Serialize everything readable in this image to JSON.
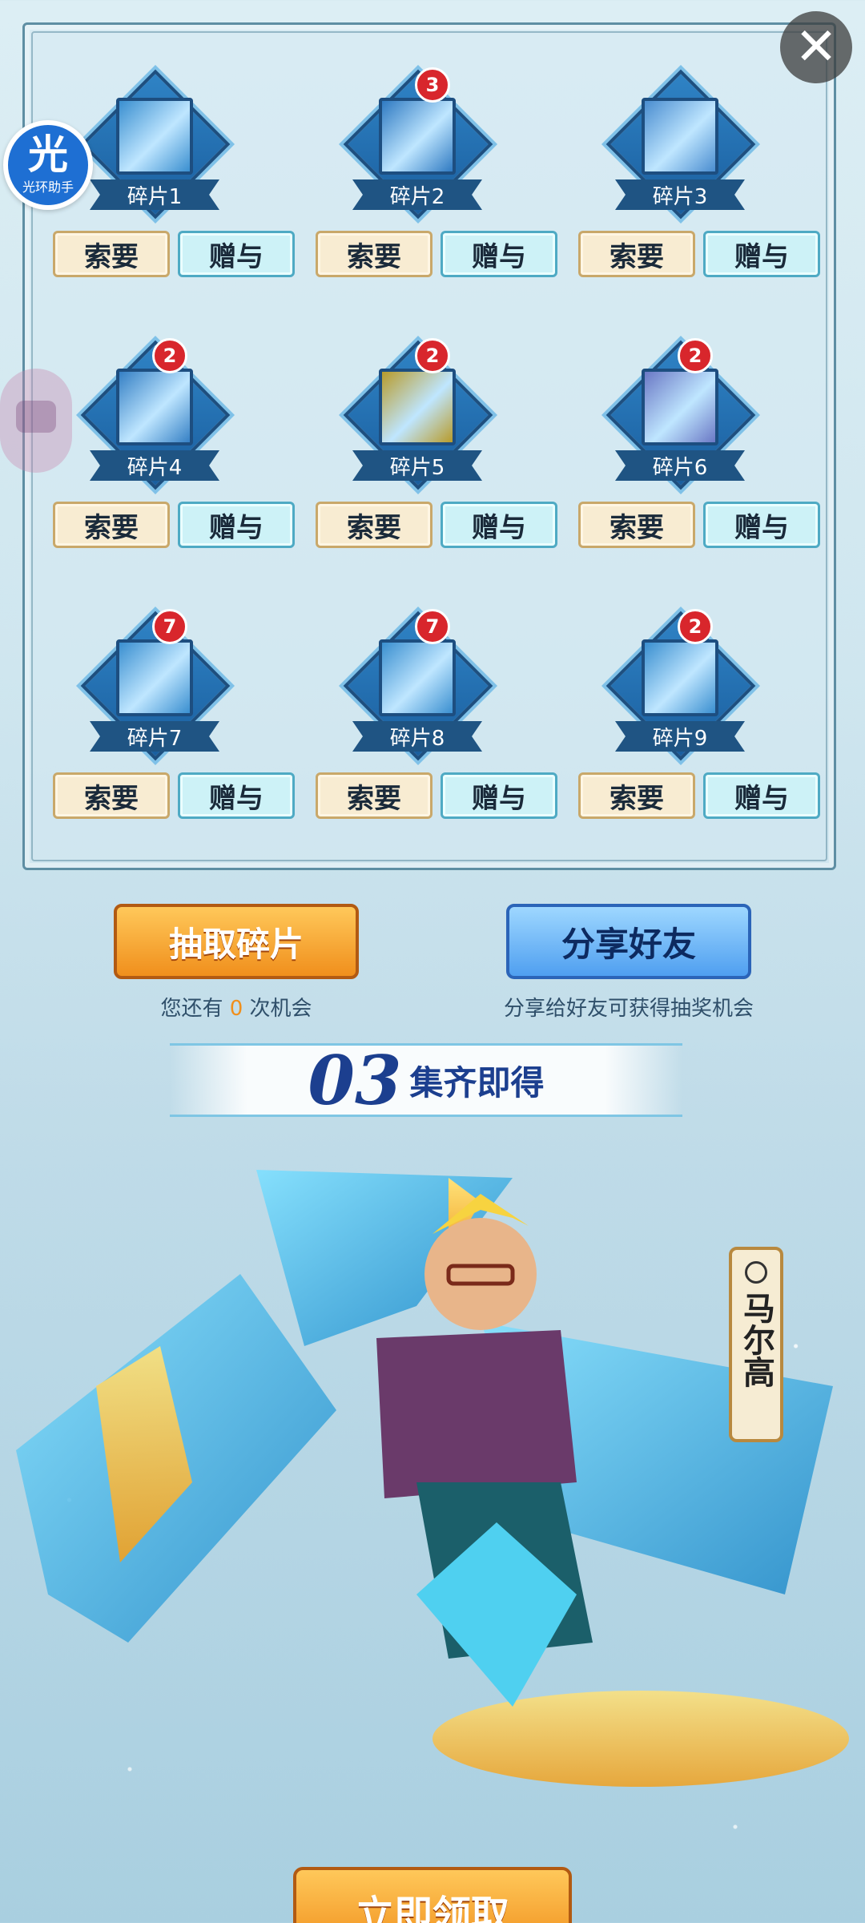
{
  "helper": {
    "badge_char": "光",
    "label": "光环助手"
  },
  "close_icon": "close-icon",
  "fragments": [
    {
      "label": "碎片1",
      "count": null,
      "color": "#3a8fd0"
    },
    {
      "label": "碎片2",
      "count": "3",
      "color": "#2f7ac2"
    },
    {
      "label": "碎片3",
      "count": null,
      "color": "#4a8dd0"
    },
    {
      "label": "碎片4",
      "count": "2",
      "color": "#3580c5"
    },
    {
      "label": "碎片5",
      "count": "2",
      "color": "#b89b2a"
    },
    {
      "label": "碎片6",
      "count": "2",
      "color": "#6a78c5"
    },
    {
      "label": "碎片7",
      "count": "7",
      "color": "#3a8fd0"
    },
    {
      "label": "碎片8",
      "count": "7",
      "color": "#3a8fd0"
    },
    {
      "label": "碎片9",
      "count": "2",
      "color": "#3a8fd0"
    }
  ],
  "buttons": {
    "ask": "索要",
    "give": "赠与"
  },
  "actions": {
    "draw": "抽取碎片",
    "share": "分享好友",
    "chance_prefix": "您还有",
    "chance_count": "0",
    "chance_suffix": "次机会",
    "share_tip": "分享给好友可获得抽奖机会"
  },
  "collect": {
    "number": "03",
    "text": "集齐即得"
  },
  "hero": {
    "name": "马尔高"
  },
  "claim": {
    "label": "立即领取"
  }
}
